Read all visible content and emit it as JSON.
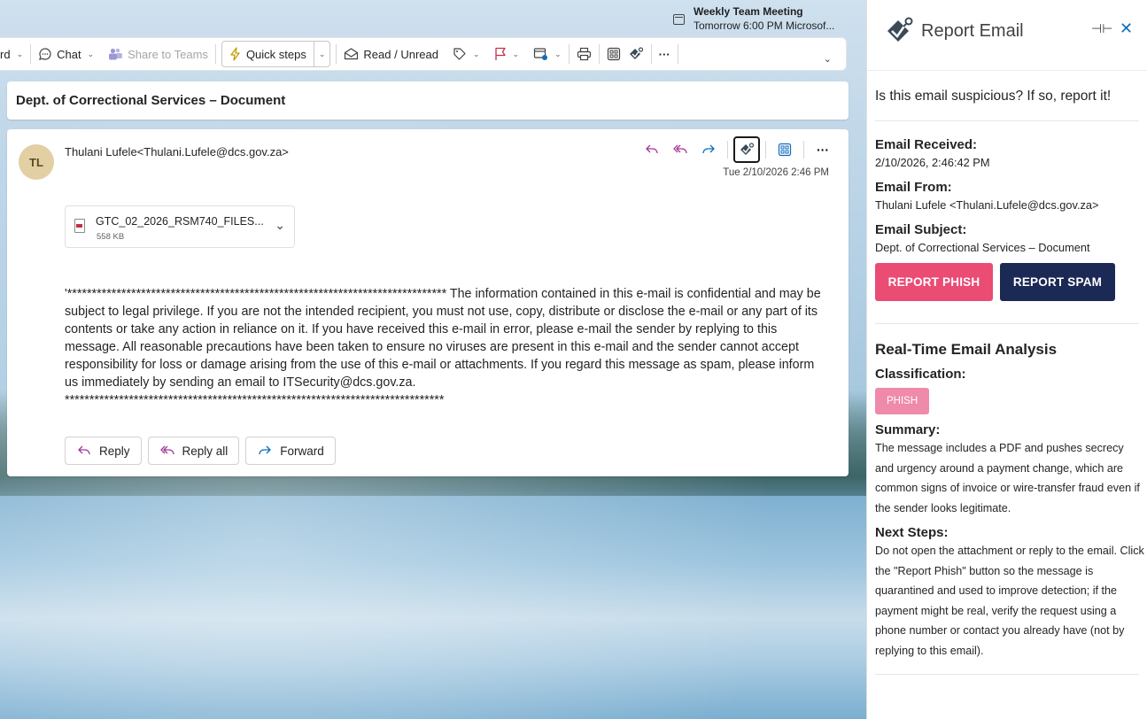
{
  "notification": {
    "title": "Weekly Team Meeting",
    "subtitle": "Tomorrow 6:00 PM Microsof..."
  },
  "toolbar": {
    "cut_label": "rd",
    "chat_label": "Chat",
    "share_label": "Share to Teams",
    "quick_steps_label": "Quick steps",
    "read_unread_label": "Read / Unread",
    "more_label": "···"
  },
  "subject": "Dept. of Correctional Services – Document",
  "message": {
    "avatar_initials": "TL",
    "sender": "Thulani Lufele<Thulani.Lufele@dcs.gov.za>",
    "date": "Tue 2/10/2026 2:46 PM",
    "attachment": {
      "name": "GTC_02_2026_RSM740_FILES....",
      "size": "558 KB"
    },
    "body_intro": "'***************************************************************************** The information contained in this e-mail is confidential and may be subject to legal privilege. If you are not the intended recipient, you must not use, copy, distribute or disclose the e-mail or any part of its contents or take any action in reliance on it. If you have received this e-mail in error, please e-mail the sender by replying to this message. All reasonable precautions have been taken to ensure no viruses are present in this e-mail and the sender cannot accept responsibility for loss or damage arising from the use of this e-mail or attachments. If you regard this message as spam, please inform us immediately by sending an email to ITSecurity@dcs.gov.za.",
    "body_footer": "*****************************************************************************",
    "reply_label": "Reply",
    "reply_all_label": "Reply all",
    "forward_label": "Forward"
  },
  "pane": {
    "title": "Report Email",
    "prompt": "Is this email suspicious? If so, report it!",
    "received_label": "Email Received:",
    "received_value": "2/10/2026, 2:46:42 PM",
    "from_label": "Email From:",
    "from_value": "Thulani Lufele <Thulani.Lufele@dcs.gov.za>",
    "subject_label": "Email Subject:",
    "subject_value": "Dept. of Correctional Services – Document",
    "report_phish_label": "REPORT PHISH",
    "report_spam_label": "REPORT SPAM",
    "analysis_heading": "Real-Time Email Analysis",
    "classification_label": "Classification:",
    "classification_value": "PHISH",
    "summary_label": "Summary:",
    "summary_text": "The message includes a PDF and pushes secrecy and urgency around a payment change, which are common signs of invoice or wire-transfer fraud even if the sender looks legitimate.",
    "next_steps_label": "Next Steps:",
    "next_steps_text": "Do not open the attachment or reply to the email. Click the \"Report Phish\" button so the message is quarantined and used to improve detection; if the payment might be real, verify the request using a phone number or contact you already have (not by replying to this email)."
  },
  "colors": {
    "phish_button": "#ea4c74",
    "spam_button": "#1b2a55",
    "phish_badge": "#ef8aaa",
    "accent_blue": "#0f6cbd",
    "reply_purple": "#a4379a"
  }
}
